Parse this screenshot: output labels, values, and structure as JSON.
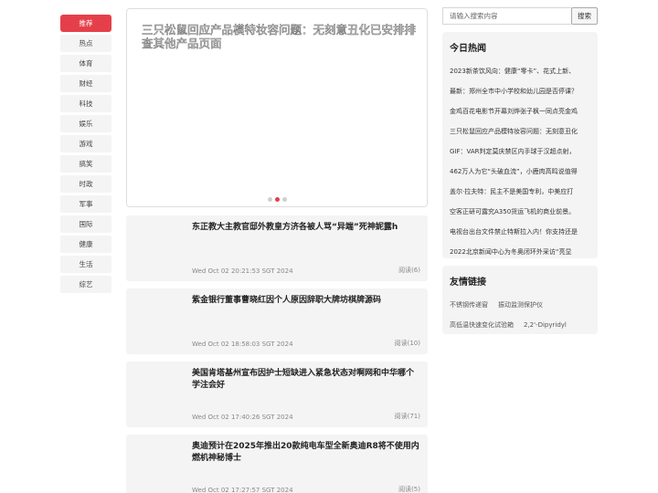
{
  "nav": {
    "items": [
      "推荐",
      "热点",
      "体育",
      "财经",
      "科技",
      "娱乐",
      "游戏",
      "搞笑",
      "时政",
      "军事",
      "国际",
      "健康",
      "生活",
      "综艺"
    ]
  },
  "carousel": {
    "title": "三只松鼠回应产品模特妆容问题：无刻意丑化已安排排查其他产品页面",
    "dot_count": 3,
    "active_dot": 1
  },
  "articles": [
    {
      "title": "东正教大主教官邸外教皇方济各被人骂“异端”死神妮露h",
      "date": "Wed Oct 02 20:21:53 SGT 2024",
      "views": "阅读(6)"
    },
    {
      "title": "紫金银行董事曹晓红因个人原因辞职大牌坊棋牌源码",
      "date": "Wed Oct 02 18:58:03 SGT 2024",
      "views": "阅读(10)"
    },
    {
      "title": "美国肯塔基州宣布因护士短缺进入紧急状态对啊网和中华哪个学注会好",
      "date": "Wed Oct 02 17:40:26 SGT 2024",
      "views": "阅读(71)"
    },
    {
      "title": "奥迪预计在2025年推出20款纯电车型全新奥迪R8将不使用内燃机神秘博士",
      "date": "Wed Oct 02 17:27:57 SGT 2024",
      "views": "阅读(5)"
    }
  ],
  "search": {
    "placeholder": "请输入搜索内容",
    "button_label": "搜索"
  },
  "hot": {
    "title": "今日热闻",
    "items": [
      "2023新茶饮风向：健康“零卡”、花式上新、",
      "最新：郑州全市中小学校和幼儿园是否停课？",
      "金鸡百花电影节开幕刘烨张子枫一同点亮金鸡",
      "三只松鼠回应产品模特妆容问题：无刻意丑化",
      "GIF：VAR判定莫庆禁区内手球于汉超点射，",
      "462万人为它“头破血流”，小鹿肉高鸣说值得",
      "盖尔·拉夫特：民主不是美国专利，中美应打",
      "空客正研可露究A350货运飞机的商业前景。",
      "电视台出台文件禁止特斯拉入内！你支持还是",
      "2022北京新闻中心为冬奥闭环外采访“亮显"
    ]
  },
  "links": {
    "title": "友情链接",
    "rows": [
      [
        "不锈钢传递窗",
        "振动监测保护仪"
      ],
      [
        "高低温快速变化试验箱",
        "2,2'-Dipyridyl"
      ]
    ]
  }
}
